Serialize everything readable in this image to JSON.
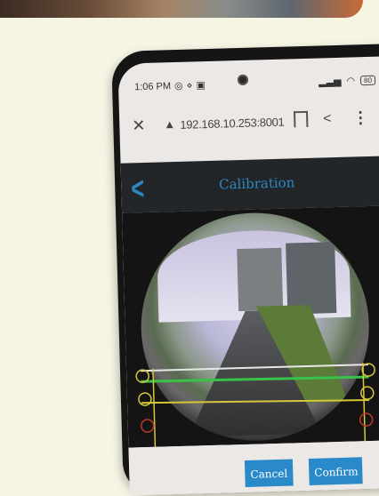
{
  "status_bar": {
    "time": "1:06 PM",
    "battery": "80"
  },
  "browser": {
    "url": "192.168.10.253:8001"
  },
  "app": {
    "title": "Calibration"
  },
  "buttons": {
    "cancel": "Cancel",
    "confirm": "Confirm"
  },
  "colors": {
    "accent": "#2a8ac9",
    "header_bg": "#222628"
  }
}
